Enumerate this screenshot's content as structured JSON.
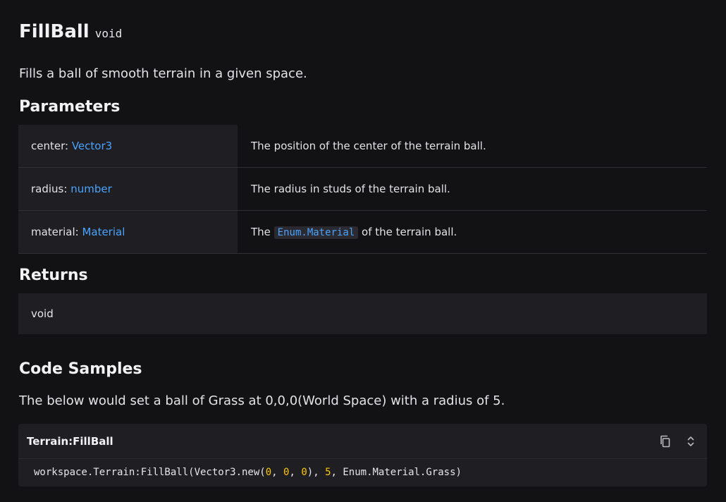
{
  "header": {
    "title": "FillBall",
    "return_type": "void"
  },
  "description": "Fills a ball of smooth terrain in a given space.",
  "parameters": {
    "heading": "Parameters",
    "rows": [
      {
        "name": "center: ",
        "type": "Vector3",
        "desc": "The position of the center of the terrain ball."
      },
      {
        "name": "radius: ",
        "type": "number",
        "desc": "The radius in studs of the terrain ball."
      },
      {
        "name": "material: ",
        "type": "Material",
        "desc_pre": "The ",
        "desc_code": "Enum.Material",
        "desc_post": " of the terrain ball."
      }
    ]
  },
  "returns": {
    "heading": "Returns",
    "value": "void"
  },
  "code_samples": {
    "heading": "Code Samples",
    "description": "The below would set a ball of Grass at 0,0,0(World Space) with a radius of 5.",
    "sample": {
      "title": "Terrain:FillBall",
      "icons": [
        "copy-icon",
        "expand-collapse-icon"
      ],
      "code_parts": {
        "p1": "workspace.Terrain:FillBall(Vector3.new(",
        "n1": "0",
        "s1": ", ",
        "n2": "0",
        "s2": ", ",
        "n3": "0",
        "s3": "), ",
        "n4": "5",
        "p2": ", Enum.Material.Grass)"
      }
    }
  },
  "colors": {
    "background": "#121215",
    "panel": "#1f1f23",
    "link": "#4aa3ff",
    "number": "#ffc600"
  }
}
